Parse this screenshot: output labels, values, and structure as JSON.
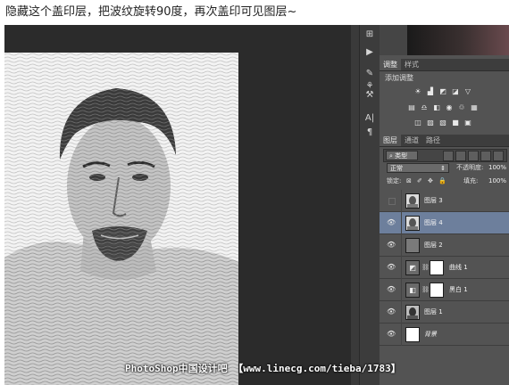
{
  "caption": "隐藏这个盖印层，把波纹旋转90度，再次盖印可见图层~",
  "panels": {
    "adjustments_tab": "调整",
    "styles_tab": "样式",
    "adjustments_title": "添加调整",
    "layers_tab": "图层",
    "channels_tab": "通道",
    "paths_tab": "路径"
  },
  "layer_controls": {
    "kind_filter": "类型",
    "blend_mode": "正常",
    "opacity_label": "不透明度:",
    "opacity_value": "100%",
    "lock_label": "锁定:",
    "fill_label": "填充:",
    "fill_value": "100%"
  },
  "layers": [
    {
      "name": "图层 3",
      "visible": false,
      "selected": false,
      "thumb": "photo"
    },
    {
      "name": "图层 4",
      "visible": true,
      "selected": true,
      "thumb": "photo"
    },
    {
      "name": "图层 2",
      "visible": true,
      "selected": false,
      "thumb": "gray"
    },
    {
      "name": "曲线 1",
      "visible": true,
      "selected": false,
      "thumb": "curves-adjustment",
      "mask": true
    },
    {
      "name": "黑白 1",
      "visible": true,
      "selected": false,
      "thumb": "bw-adjustment",
      "mask": true
    },
    {
      "name": "图层 1",
      "visible": true,
      "selected": false,
      "thumb": "photo"
    },
    {
      "name": "背景",
      "visible": true,
      "selected": false,
      "thumb": "white",
      "italic": true
    }
  ],
  "watermark": "PhotoShop中国设计吧 【www.linecg.com/tieba/1783】",
  "colors": {
    "panel_bg": "#535353",
    "selected_layer": "#6d7f9c",
    "canvas_bg": "#2b2b2b"
  }
}
